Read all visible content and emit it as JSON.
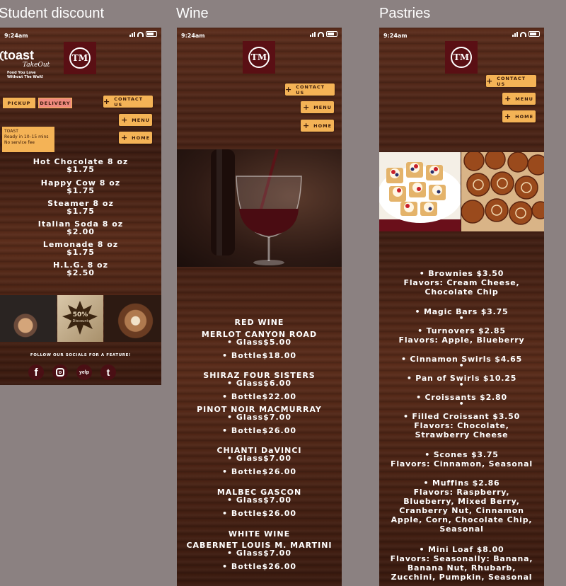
{
  "frames": {
    "student": {
      "title": "Student discount",
      "time": "9:24am",
      "toast_brand": "toast",
      "toast_sub": "TakeOut",
      "toast_tagline": "Food You Love Without The Wait!",
      "logo_text": "TM",
      "pickup_label": "PICKUP",
      "delivery_label": "DELIVERY",
      "buttons": {
        "contact": "CONTACT US",
        "menu": "MENU",
        "home": "HOME"
      },
      "notice": {
        "line1": "TOAST",
        "line2": "Ready in 10–15 mins",
        "line3": "No service fee"
      },
      "items": [
        {
          "name": "Hot Chocolate 8 oz",
          "price": "$1.75"
        },
        {
          "name": "Happy Cow 8 oz",
          "price": "$1.75"
        },
        {
          "name": "Steamer 8 oz",
          "price": "$1.75"
        },
        {
          "name": "Italian Soda 8 oz",
          "price": "$2.00"
        },
        {
          "name": "Lemonade 8 oz",
          "price": "$1.75"
        },
        {
          "name": "H.L.G. 8 oz",
          "price": "$2.50"
        }
      ],
      "discount_badge": {
        "pct": "50%",
        "label": "Discount"
      },
      "socials_label": "FOLLOW OUR SOCIALS FOR A FEATURE!",
      "socials": [
        "f",
        "yelp",
        "t"
      ]
    },
    "wine": {
      "title": "Wine",
      "time": "9:24am",
      "logo_text": "TM",
      "buttons": {
        "contact": "CONTACT US",
        "menu": "MENU",
        "home": "HOME"
      },
      "sections": [
        {
          "heading": "RED WINE",
          "wines": [
            {
              "name": "MERLOT CANYON ROAD",
              "glass": "• Glass$5.00",
              "bottle": "• Bottle$18.00"
            },
            {
              "name": "SHIRAZ FOUR SISTERS",
              "glass": "• Glass$6.00",
              "bottle": "• Bottle$22.00"
            },
            {
              "name": "PINOT NOIR MACMURRAY",
              "glass": "• Glass$7.00",
              "bottle": "• Bottle$26.00"
            },
            {
              "name": "CHIANTI DaVINCI",
              "glass": "• Glass$7.00",
              "bottle": "• Bottle$26.00"
            },
            {
              "name": "MALBEC GASCON",
              "glass": "• Glass$7.00",
              "bottle": "• Bottle$26.00"
            }
          ]
        },
        {
          "heading": "WHITE WINE",
          "wines": [
            {
              "name": "CABERNET LOUIS M. MARTINI",
              "glass": "• Glass$7.00",
              "bottle": "• Bottle$26.00"
            }
          ]
        }
      ]
    },
    "pastries": {
      "title": "Pastries",
      "time": "9:24am",
      "logo_text": "TM",
      "buttons": {
        "contact": "CONTACT US",
        "menu": "MENU",
        "home": "HOME"
      },
      "items": [
        {
          "line1": "• Brownies  $3.50",
          "lines": [
            "Flavors: Cream Cheese,",
            "Chocolate Chip"
          ]
        },
        {
          "line1": "• Magic Bars  $3.75",
          "lines": [
            "•"
          ]
        },
        {
          "line1": "• Turnovers  $2.85",
          "lines": [
            "Flavors: Apple, Blueberry"
          ]
        },
        {
          "line1": "• Cinnamon Swirls  $4.65",
          "lines": [
            "•"
          ]
        },
        {
          "line1": "• Pan of Swirls  $10.25",
          "lines": [
            "•"
          ]
        },
        {
          "line1": "• Croissants  $2.80",
          "lines": [
            "•"
          ]
        },
        {
          "line1": "• Filled Croissant  $3.50",
          "lines": [
            "Flavors: Chocolate,",
            "Strawberry Cheese"
          ]
        },
        {
          "line1": "• Scones  $3.75",
          "lines": [
            "Flavors: Cinnamon, Seasonal"
          ]
        },
        {
          "line1": "• Muffins  $2.86",
          "lines": [
            "Flavors: Raspberry,",
            "Blueberry, Mixed Berry,",
            "Cranberry Nut, Cinnamon",
            "Apple, Corn, Chocolate Chip,",
            "Seasonal"
          ]
        },
        {
          "line1": "• Mini Loaf  $8.00",
          "lines": [
            "Flavors: Seasonally: Banana,",
            "Banana Nut, Rhubarb,",
            "Zucchini, Pumpkin, Seasonal"
          ]
        }
      ]
    }
  },
  "colors": {
    "accent": "#f4b356",
    "logo_bg": "#5a0f14",
    "canvas": "#8b8181"
  }
}
